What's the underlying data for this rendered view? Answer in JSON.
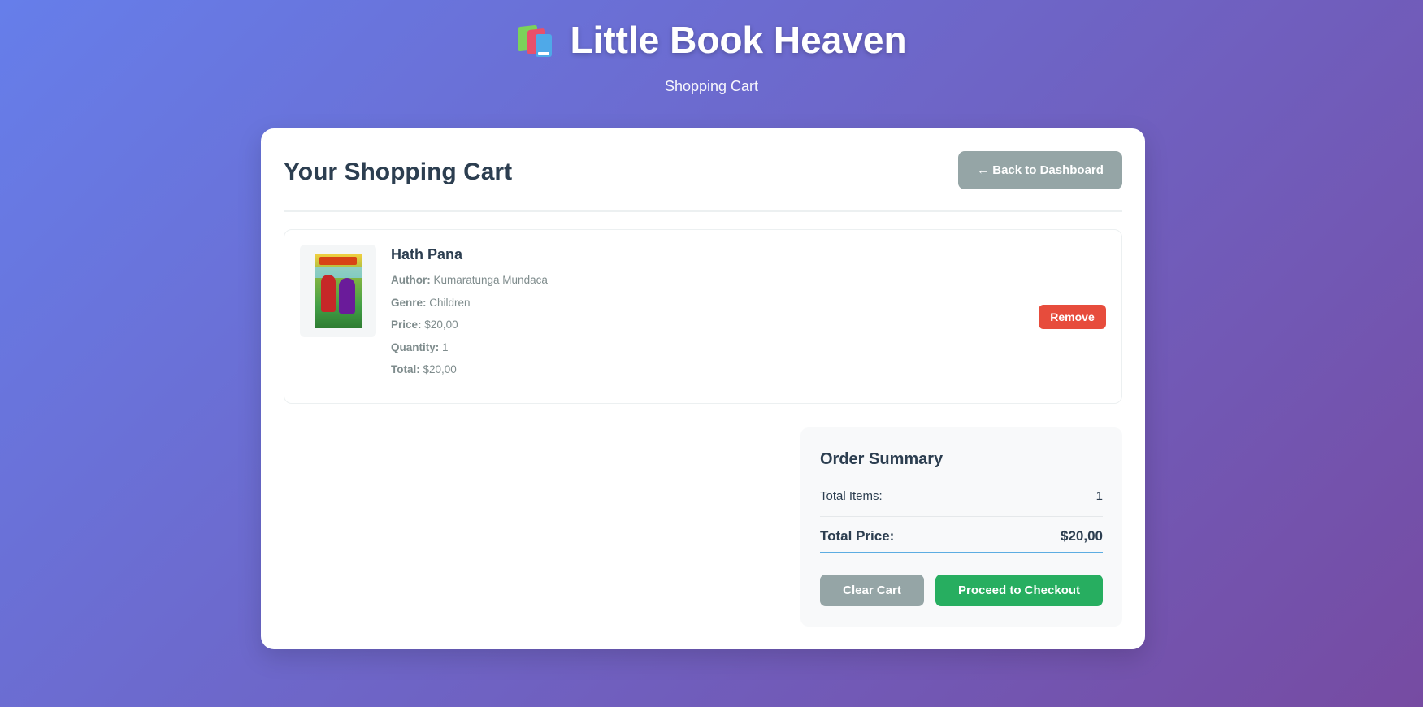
{
  "header": {
    "logo_icon": "books-icon",
    "title": "Little Book Heaven",
    "subtitle": "Shopping Cart"
  },
  "cart": {
    "title": "Your Shopping Cart",
    "back_label": "← Back to Dashboard",
    "items": [
      {
        "title": "Hath Pana",
        "author_label": "Author:",
        "author": "Kumaratunga Mundaca",
        "genre_label": "Genre:",
        "genre": "Children",
        "price_label": "Price:",
        "price": "$20,00",
        "quantity_label": "Quantity:",
        "quantity": "1",
        "total_label": "Total:",
        "total": "$20,00",
        "remove_label": "Remove"
      }
    ]
  },
  "summary": {
    "title": "Order Summary",
    "items_label": "Total Items:",
    "items_value": "1",
    "price_label": "Total Price:",
    "price_value": "$20,00",
    "clear_label": "Clear Cart",
    "checkout_label": "Proceed to Checkout"
  },
  "colors": {
    "gradient_start": "#667eea",
    "gradient_end": "#764ba2",
    "remove": "#e74c3c",
    "checkout": "#27ae60",
    "secondary": "#95a5a6"
  }
}
